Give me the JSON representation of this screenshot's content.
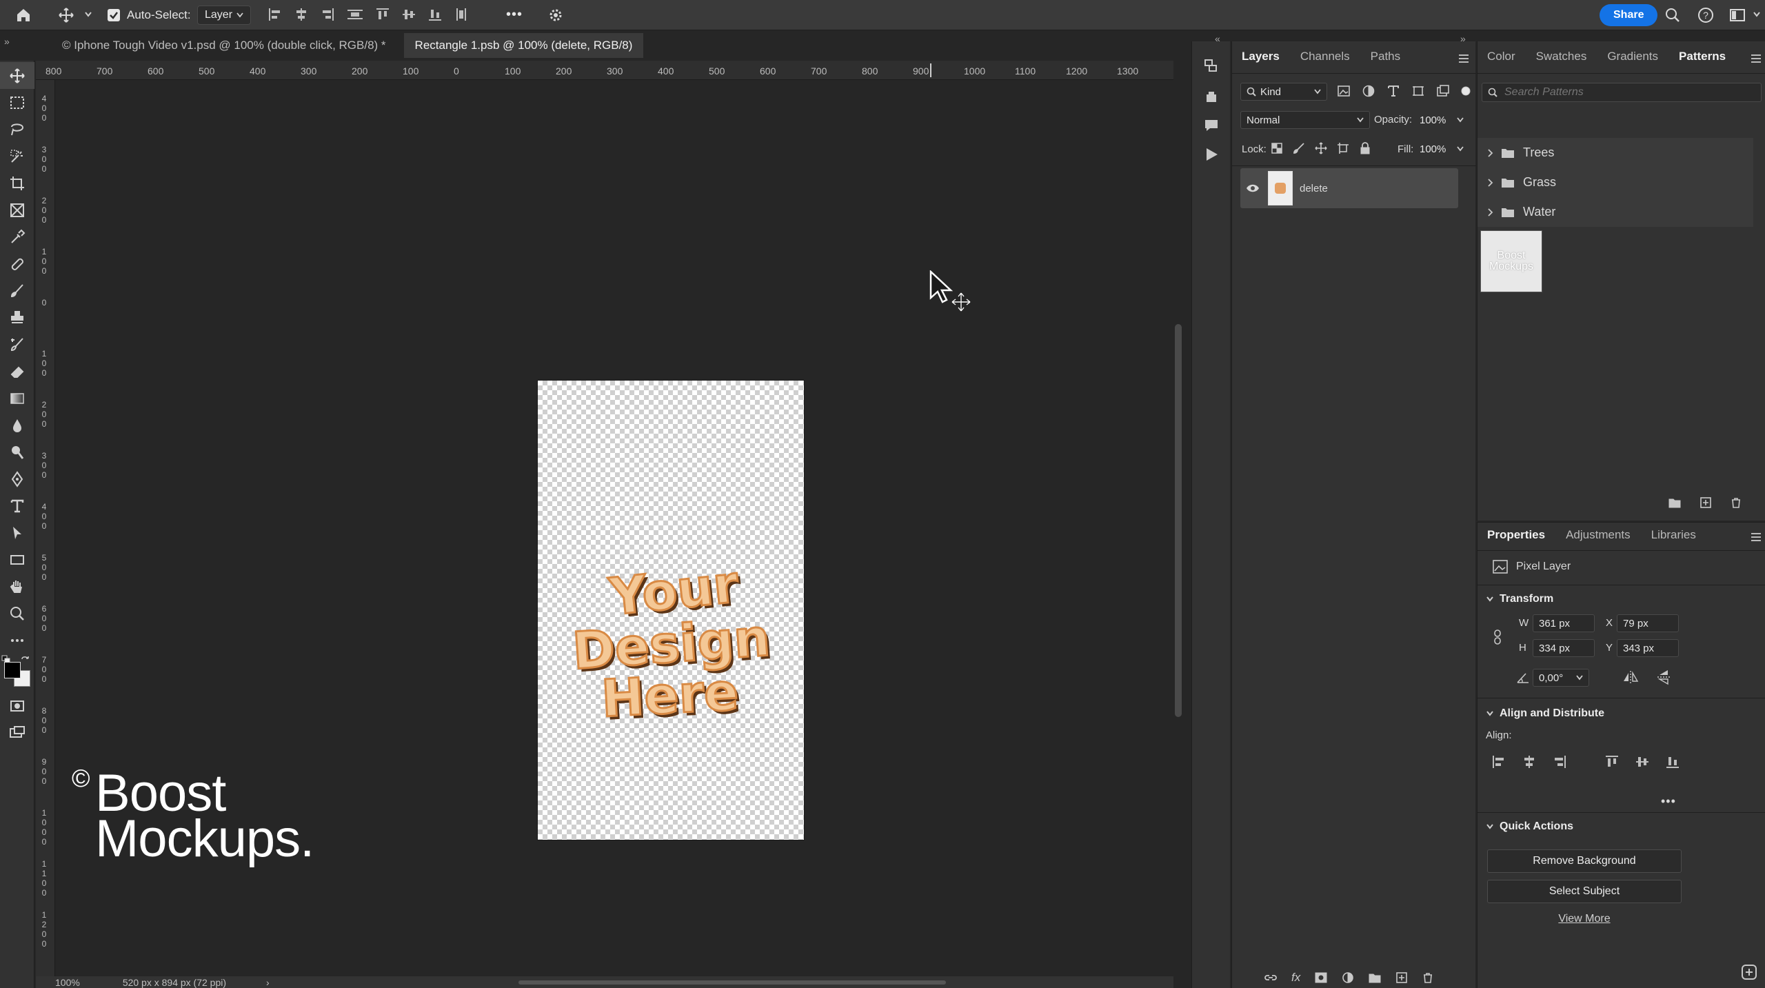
{
  "options_bar": {
    "auto_select_label": "Auto-Select:",
    "auto_select_checked": true,
    "auto_select_target": "Layer",
    "more_label": "•••",
    "share_label": "Share"
  },
  "tabs": [
    {
      "label": "© Iphone Tough Video v1.psd @ 100% (double click, RGB/8) *"
    },
    {
      "label": "Rectangle 1.psb @ 100% (delete, RGB/8)"
    }
  ],
  "rulers": {
    "top": [
      "800",
      "700",
      "600",
      "500",
      "400",
      "300",
      "200",
      "100",
      "0",
      "100",
      "200",
      "300",
      "400",
      "500",
      "600",
      "700",
      "800",
      "900",
      "1000",
      "1100",
      "1200",
      "1300"
    ],
    "left": [
      "4\n0\n0",
      "3\n0\n0",
      "2\n0\n0",
      "1\n0\n0",
      "0",
      "1\n0\n0",
      "2\n0\n0",
      "3\n0\n0",
      "4\n0\n0",
      "5\n0\n0",
      "6\n0\n0",
      "7\n0\n0",
      "8\n0\n0",
      "9\n0\n0",
      "1\n0\n0\n0",
      "1\n1\n0\n0",
      "1\n2\n0\n0"
    ]
  },
  "canvas": {
    "design_text": [
      "Your",
      "Design",
      "Here"
    ],
    "watermark": {
      "line1": "Boost",
      "line2": "Mockups.",
      "symbol": "©"
    }
  },
  "status_bar": {
    "zoom": "100%",
    "doc_size": "520 px x 894 px (72 ppi)"
  },
  "layers_panel": {
    "tabs": [
      "Layers",
      "Channels",
      "Paths"
    ],
    "active_tab": "Layers",
    "filter_label": "Kind",
    "blend_mode": "Normal",
    "opacity_label": "Opacity:",
    "opacity_value": "100%",
    "lock_label": "Lock:",
    "fill_label": "Fill:",
    "fill_value": "100%",
    "layers": [
      {
        "name": "delete",
        "visible": true
      }
    ]
  },
  "patterns_panel": {
    "tabs": [
      "Color",
      "Swatches",
      "Gradients",
      "Patterns"
    ],
    "active_tab": "Patterns",
    "search_placeholder": "Search Patterns",
    "groups": [
      "Trees",
      "Grass",
      "Water"
    ],
    "thumbnail_text": "Boost Mockups"
  },
  "properties_panel": {
    "tabs": [
      "Properties",
      "Adjustments",
      "Libraries"
    ],
    "active_tab": "Properties",
    "layer_type": "Pixel Layer",
    "transform_label": "Transform",
    "w_label": "W",
    "w_value": "361 px",
    "h_label": "H",
    "h_value": "334 px",
    "x_label": "X",
    "x_value": "79 px",
    "y_label": "Y",
    "y_value": "343 px",
    "angle_value": "0,00°",
    "align_distribute_label": "Align and Distribute",
    "align_label": "Align:",
    "more_label": "•••",
    "quick_actions_label": "Quick Actions",
    "remove_background_label": "Remove Background",
    "select_subject_label": "Select Subject",
    "view_more_label": "View More"
  },
  "colors": {
    "accent": "#1473e6",
    "design_fill": "#f4c896",
    "design_stroke": "#d98a44",
    "design_shadow": "#5b3416"
  }
}
